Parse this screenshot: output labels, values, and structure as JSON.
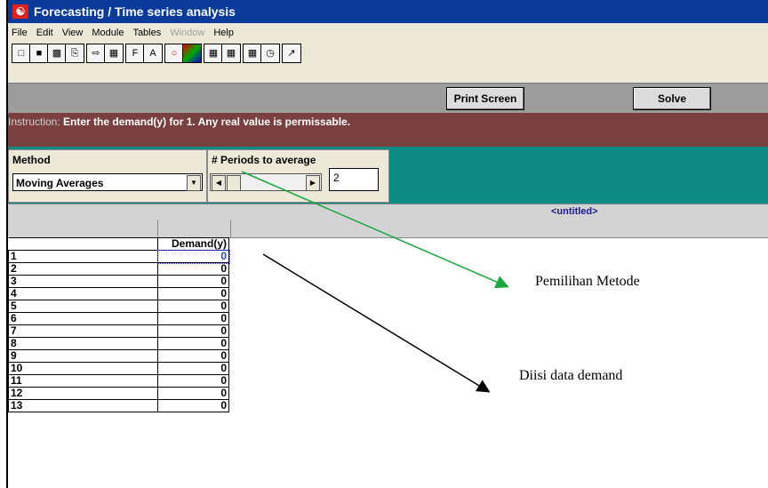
{
  "window": {
    "title": "Forecasting / Time series analysis"
  },
  "menu": [
    {
      "label": "File",
      "enabled": true
    },
    {
      "label": "Edit",
      "enabled": true
    },
    {
      "label": "View",
      "enabled": true
    },
    {
      "label": "Module",
      "enabled": true
    },
    {
      "label": "Tables",
      "enabled": true
    },
    {
      "label": "Window",
      "enabled": false
    },
    {
      "label": "Help",
      "enabled": true
    }
  ],
  "toolbar_icons": [
    "new-icon",
    "open-icon",
    "save-icon",
    "print-icon",
    "insert-row-icon",
    "table-icon",
    "font-icon",
    "font-size-icon",
    "zero-icon",
    "color-icon",
    "grid-icon",
    "grid-alt-icon",
    "calculator-icon",
    "clock-icon",
    "wizard-icon"
  ],
  "buttons": {
    "print_screen": "Print Screen",
    "solve": "Solve"
  },
  "instruction": {
    "prefix": "Instruction:",
    "text": "Enter the demand(y) for  1. Any real value is permissable."
  },
  "method": {
    "caption": "Method",
    "selected": "Moving Averages"
  },
  "periods": {
    "caption": "# Periods to average",
    "value": "2"
  },
  "file": {
    "name": "<untitled>"
  },
  "table": {
    "header": "Demand(y)",
    "rows": [
      {
        "label": "1",
        "value": "0"
      },
      {
        "label": "2",
        "value": "0"
      },
      {
        "label": "3",
        "value": "0"
      },
      {
        "label": "4",
        "value": "0"
      },
      {
        "label": "5",
        "value": "0"
      },
      {
        "label": "6",
        "value": "0"
      },
      {
        "label": "7",
        "value": "0"
      },
      {
        "label": "8",
        "value": "0"
      },
      {
        "label": "9",
        "value": "0"
      },
      {
        "label": "10",
        "value": "0"
      },
      {
        "label": "11",
        "value": "0"
      },
      {
        "label": "12",
        "value": "0"
      },
      {
        "label": "13",
        "value": "0"
      }
    ]
  },
  "annotations": {
    "method_note": "Pemilihan Metode",
    "demand_note": "Diisi data demand"
  },
  "colors": {
    "titlebar": "#0a3a9a",
    "instruction_bg": "#7a4040",
    "params_bg": "#0d8a84",
    "green_arrow": "#1aa640",
    "black_arrow": "#000000"
  }
}
